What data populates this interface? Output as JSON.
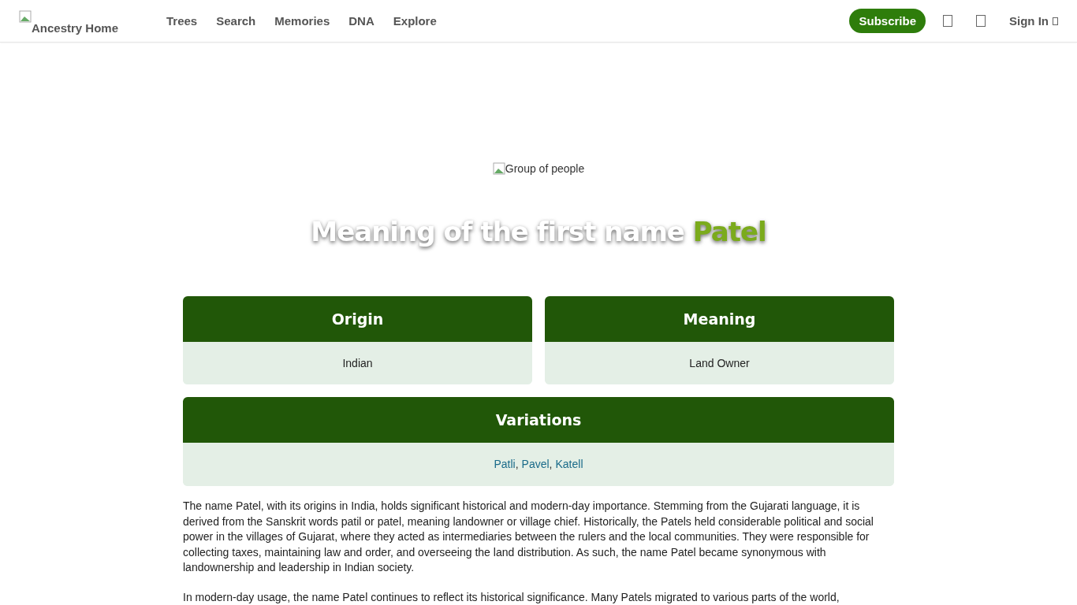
{
  "header": {
    "logo_alt": "Ancestry Home",
    "nav": [
      "Trees",
      "Search",
      "Memories",
      "DNA",
      "Explore"
    ],
    "subscribe": "Subscribe",
    "sign_in": "Sign In"
  },
  "hero": {
    "image_alt": "Group of people",
    "title_prefix": "Meaning of the first name",
    "title_name": "Patel"
  },
  "cards": [
    {
      "heading": "Origin",
      "value": "Indian"
    },
    {
      "heading": "Meaning",
      "value": "Land Owner"
    }
  ],
  "variations": {
    "heading": "Variations",
    "separator": ",",
    "names": [
      "Patli",
      "Pavel",
      "Katell"
    ]
  },
  "paragraphs": [
    "The name Patel, with its origins in India, holds significant historical and modern-day importance. Stemming from the Gujarati language, it is derived from the Sanskrit words patil or patel, meaning landowner or village chief. Historically, the Patels held considerable political and social power in the villages of Gujarat, where they acted as intermediaries between the rulers and the local communities. They were responsible for collecting taxes, maintaining law and order, and overseeing the land distribution. As such, the name Patel became synonymous with landownership and leadership in Indian society.",
    "In modern-day usage, the name Patel continues to reflect its historical significance. Many Patels migrated to various parts of the world,"
  ]
}
